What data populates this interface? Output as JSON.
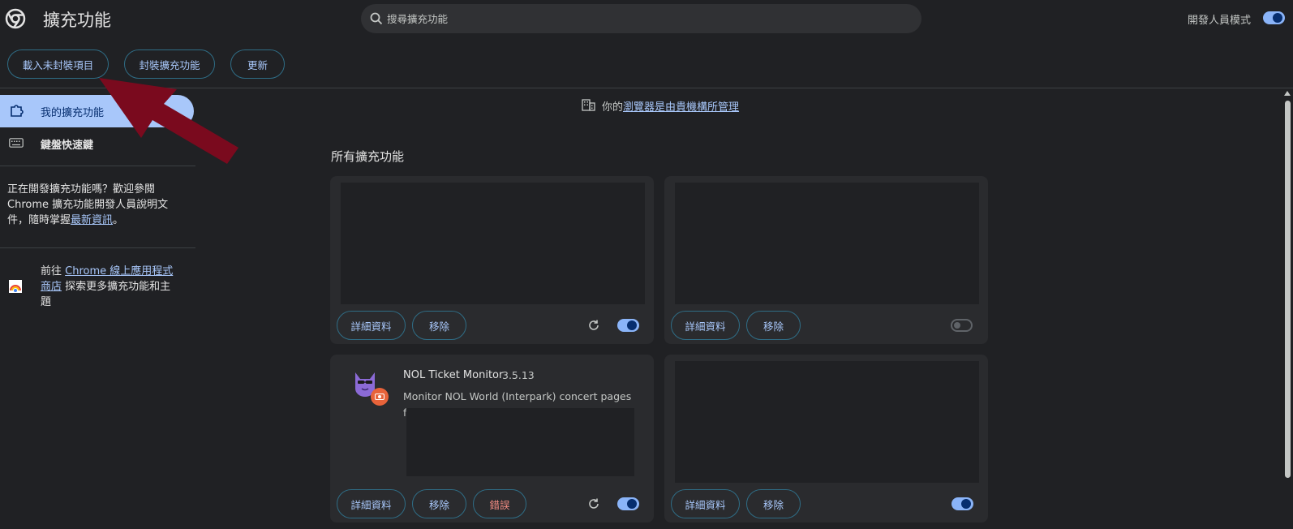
{
  "header": {
    "title": "擴充功能",
    "search_placeholder": "搜尋擴充功能",
    "dev_mode_label": "開發人員模式",
    "dev_mode_on": true
  },
  "toolbar": {
    "load_unpacked": "載入未封裝項目",
    "pack_extension": "封裝擴充功能",
    "update": "更新"
  },
  "sidebar": {
    "my_extensions": "我的擴充功能",
    "keyboard_shortcuts": "鍵盤快速鍵",
    "dev_text_pre": "正在開發擴充功能嗎？歡迎參閱 Chrome 擴充功能開發人員說明文件，隨時掌握",
    "dev_text_link": "最新資訊",
    "dev_text_post": "。",
    "store_pre": "前往 ",
    "store_link": "Chrome 線上應用程式商店",
    "store_post": " 探索更多擴充功能和主題"
  },
  "main": {
    "managed_pre": "你的",
    "managed_link": "瀏覽器是由貴機構所管理",
    "section_title": "所有擴充功能",
    "details_label": "詳細資料",
    "remove_label": "移除",
    "errors_label": "錯誤",
    "cards": [
      {
        "enabled": true
      },
      {
        "enabled": false
      },
      {
        "name": "NOL Ticket Monitor",
        "version": "3.5.13",
        "description": "Monitor NOL World (Interpark) concert pages for",
        "enabled": true
      },
      {
        "enabled": true
      }
    ]
  },
  "colors": {
    "accent": "#a8c7fa",
    "error": "#f28b82",
    "overlay_arrow": "#7a0a1e"
  }
}
